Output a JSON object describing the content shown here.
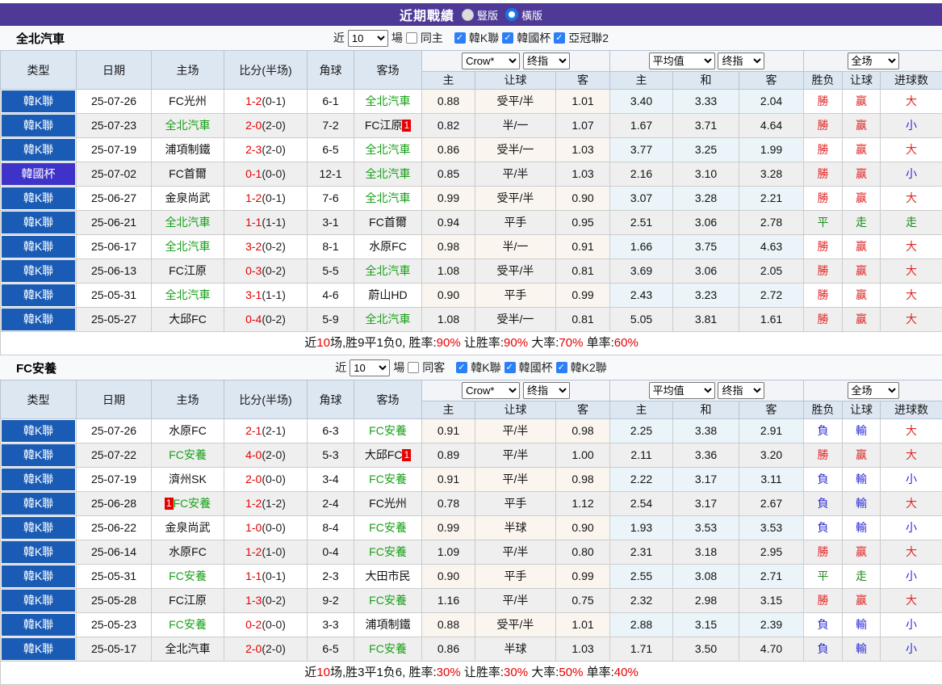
{
  "topbar": {
    "title": "近期戰績",
    "vertical": "豎版",
    "horizontal": "橫版"
  },
  "colors": {
    "topbar_purple": "#4e3a96",
    "k_league_blue": "#1a5cb5",
    "cup_league_purple": "#3e32c8",
    "team_green": "#18a018",
    "score_red": "#e60000",
    "win_red": "#e02626",
    "draw_green": "#1f8a1f",
    "lose_blue": "#2c2cd4"
  },
  "labels": {
    "near": "近",
    "games": "場"
  },
  "headers": {
    "type": "类型",
    "date": "日期",
    "home": "主场",
    "score": "比分(半场)",
    "corner": "角球",
    "away": "客场",
    "selects": {
      "bookmaker": "Crow*",
      "final1": "终指",
      "average": "平均值",
      "final2": "终指",
      "scope": "全场"
    },
    "sub": [
      "主",
      "让球",
      "客",
      "主",
      "和",
      "客",
      "胜负",
      "让球",
      "进球数"
    ]
  },
  "sections": [
    {
      "team": "全北汽車",
      "filter": {
        "count": "10",
        "same_label": "同主",
        "leagues": [
          "韓K聯",
          "韓國杯",
          "亞冠聯2"
        ]
      },
      "rows": [
        {
          "lg": "k",
          "league": "韓K聯",
          "date": "25-07-26",
          "home": {
            "name": "FC光州",
            "green": false
          },
          "score": "1-2",
          "half": "(0-1)",
          "corner": "6-1",
          "away": {
            "name": "全北汽車",
            "green": true
          },
          "crow": [
            "0.88",
            "受平/半",
            "1.01"
          ],
          "avg": [
            "3.40",
            "3.33",
            "2.04"
          ],
          "res": [
            [
              "勝",
              "r"
            ],
            [
              "赢",
              "r"
            ],
            [
              "大",
              "r"
            ]
          ]
        },
        {
          "lg": "k",
          "league": "韓K聯",
          "date": "25-07-23",
          "home": {
            "name": "全北汽車",
            "green": true
          },
          "score": "2-0",
          "half": "(2-0)",
          "corner": "7-2",
          "away": {
            "name": "FC江原",
            "green": false,
            "badge": "1",
            "badgePos": "after"
          },
          "crow": [
            "0.82",
            "半/一",
            "1.07"
          ],
          "avg": [
            "1.67",
            "3.71",
            "4.64"
          ],
          "res": [
            [
              "勝",
              "r"
            ],
            [
              "赢",
              "r"
            ],
            [
              "小",
              "b"
            ]
          ]
        },
        {
          "lg": "k",
          "league": "韓K聯",
          "date": "25-07-19",
          "home": {
            "name": "浦項制鐵",
            "green": false
          },
          "score": "2-3",
          "half": "(2-0)",
          "corner": "6-5",
          "away": {
            "name": "全北汽車",
            "green": true
          },
          "crow": [
            "0.86",
            "受半/一",
            "1.03"
          ],
          "avg": [
            "3.77",
            "3.25",
            "1.99"
          ],
          "res": [
            [
              "勝",
              "r"
            ],
            [
              "赢",
              "r"
            ],
            [
              "大",
              "r"
            ]
          ]
        },
        {
          "lg": "cup",
          "league": "韓國杯",
          "date": "25-07-02",
          "home": {
            "name": "FC首爾",
            "green": false
          },
          "score": "0-1",
          "half": "(0-0)",
          "corner": "12-1",
          "away": {
            "name": "全北汽車",
            "green": true
          },
          "crow": [
            "0.85",
            "平/半",
            "1.03"
          ],
          "avg": [
            "2.16",
            "3.10",
            "3.28"
          ],
          "res": [
            [
              "勝",
              "r"
            ],
            [
              "赢",
              "r"
            ],
            [
              "小",
              "b"
            ]
          ]
        },
        {
          "lg": "k",
          "league": "韓K聯",
          "date": "25-06-27",
          "home": {
            "name": "金泉尚武",
            "green": false
          },
          "score": "1-2",
          "half": "(0-1)",
          "corner": "7-6",
          "away": {
            "name": "全北汽車",
            "green": true
          },
          "crow": [
            "0.99",
            "受平/半",
            "0.90"
          ],
          "avg": [
            "3.07",
            "3.28",
            "2.21"
          ],
          "res": [
            [
              "勝",
              "r"
            ],
            [
              "赢",
              "r"
            ],
            [
              "大",
              "r"
            ]
          ]
        },
        {
          "lg": "k",
          "league": "韓K聯",
          "date": "25-06-21",
          "home": {
            "name": "全北汽車",
            "green": true
          },
          "score": "1-1",
          "half": "(1-1)",
          "corner": "3-1",
          "away": {
            "name": "FC首爾",
            "green": false
          },
          "crow": [
            "0.94",
            "平手",
            "0.95"
          ],
          "avg": [
            "2.51",
            "3.06",
            "2.78"
          ],
          "res": [
            [
              "平",
              "g"
            ],
            [
              "走",
              "g"
            ],
            [
              "走",
              "g"
            ]
          ]
        },
        {
          "lg": "k",
          "league": "韓K聯",
          "date": "25-06-17",
          "home": {
            "name": "全北汽車",
            "green": true
          },
          "score": "3-2",
          "half": "(0-2)",
          "corner": "8-1",
          "away": {
            "name": "水原FC",
            "green": false
          },
          "crow": [
            "0.98",
            "半/一",
            "0.91"
          ],
          "avg": [
            "1.66",
            "3.75",
            "4.63"
          ],
          "res": [
            [
              "勝",
              "r"
            ],
            [
              "赢",
              "r"
            ],
            [
              "大",
              "r"
            ]
          ]
        },
        {
          "lg": "k",
          "league": "韓K聯",
          "date": "25-06-13",
          "home": {
            "name": "FC江原",
            "green": false
          },
          "score": "0-3",
          "half": "(0-2)",
          "corner": "5-5",
          "away": {
            "name": "全北汽車",
            "green": true
          },
          "crow": [
            "1.08",
            "受平/半",
            "0.81"
          ],
          "avg": [
            "3.69",
            "3.06",
            "2.05"
          ],
          "res": [
            [
              "勝",
              "r"
            ],
            [
              "赢",
              "r"
            ],
            [
              "大",
              "r"
            ]
          ]
        },
        {
          "lg": "k",
          "league": "韓K聯",
          "date": "25-05-31",
          "home": {
            "name": "全北汽車",
            "green": true
          },
          "score": "3-1",
          "half": "(1-1)",
          "corner": "4-6",
          "away": {
            "name": "蔚山HD",
            "green": false
          },
          "crow": [
            "0.90",
            "平手",
            "0.99"
          ],
          "avg": [
            "2.43",
            "3.23",
            "2.72"
          ],
          "res": [
            [
              "勝",
              "r"
            ],
            [
              "赢",
              "r"
            ],
            [
              "大",
              "r"
            ]
          ]
        },
        {
          "lg": "k",
          "league": "韓K聯",
          "date": "25-05-27",
          "home": {
            "name": "大邱FC",
            "green": false
          },
          "score": "0-4",
          "half": "(0-2)",
          "corner": "5-9",
          "away": {
            "name": "全北汽車",
            "green": true
          },
          "crow": [
            "1.08",
            "受半/一",
            "0.81"
          ],
          "avg": [
            "5.05",
            "3.81",
            "1.61"
          ],
          "res": [
            [
              "勝",
              "r"
            ],
            [
              "赢",
              "r"
            ],
            [
              "大",
              "r"
            ]
          ]
        }
      ],
      "summary": [
        {
          "t": "近",
          "r": false
        },
        {
          "t": "10",
          "r": true
        },
        {
          "t": "场,胜9平1负0, 胜率:",
          "r": false
        },
        {
          "t": "90%",
          "r": true
        },
        {
          "t": " 让胜率:",
          "r": false
        },
        {
          "t": "90%",
          "r": true
        },
        {
          "t": " 大率:",
          "r": false
        },
        {
          "t": "70%",
          "r": true
        },
        {
          "t": " 单率:",
          "r": false
        },
        {
          "t": "60%",
          "r": true
        }
      ]
    },
    {
      "team": "FC安養",
      "filter": {
        "count": "10",
        "same_label": "同客",
        "leagues": [
          "韓K聯",
          "韓國杯",
          "韓K2聯"
        ]
      },
      "rows": [
        {
          "lg": "k",
          "league": "韓K聯",
          "date": "25-07-26",
          "home": {
            "name": "水原FC",
            "green": false
          },
          "score": "2-1",
          "half": "(2-1)",
          "corner": "6-3",
          "away": {
            "name": "FC安養",
            "green": true
          },
          "crow": [
            "0.91",
            "平/半",
            "0.98"
          ],
          "avg": [
            "2.25",
            "3.38",
            "2.91"
          ],
          "res": [
            [
              "負",
              "b"
            ],
            [
              "輸",
              "b"
            ],
            [
              "大",
              "r"
            ]
          ]
        },
        {
          "lg": "k",
          "league": "韓K聯",
          "date": "25-07-22",
          "home": {
            "name": "FC安養",
            "green": true
          },
          "score": "4-0",
          "half": "(2-0)",
          "corner": "5-3",
          "away": {
            "name": "大邱FC",
            "green": false,
            "badge": "1",
            "badgePos": "after"
          },
          "crow": [
            "0.89",
            "平/半",
            "1.00"
          ],
          "avg": [
            "2.11",
            "3.36",
            "3.20"
          ],
          "res": [
            [
              "勝",
              "r"
            ],
            [
              "赢",
              "r"
            ],
            [
              "大",
              "r"
            ]
          ]
        },
        {
          "lg": "k",
          "league": "韓K聯",
          "date": "25-07-19",
          "home": {
            "name": "濟州SK",
            "green": false
          },
          "score": "2-0",
          "half": "(0-0)",
          "corner": "3-4",
          "away": {
            "name": "FC安養",
            "green": true
          },
          "crow": [
            "0.91",
            "平/半",
            "0.98"
          ],
          "avg": [
            "2.22",
            "3.17",
            "3.11"
          ],
          "res": [
            [
              "負",
              "b"
            ],
            [
              "輸",
              "b"
            ],
            [
              "小",
              "b"
            ]
          ]
        },
        {
          "lg": "k",
          "league": "韓K聯",
          "date": "25-06-28",
          "home": {
            "name": "FC安養",
            "green": true,
            "badge": "1",
            "badgePos": "before"
          },
          "score": "1-2",
          "half": "(1-2)",
          "corner": "2-4",
          "away": {
            "name": "FC光州",
            "green": false
          },
          "crow": [
            "0.78",
            "平手",
            "1.12"
          ],
          "avg": [
            "2.54",
            "3.17",
            "2.67"
          ],
          "res": [
            [
              "負",
              "b"
            ],
            [
              "輸",
              "b"
            ],
            [
              "大",
              "r"
            ]
          ]
        },
        {
          "lg": "k",
          "league": "韓K聯",
          "date": "25-06-22",
          "home": {
            "name": "金泉尚武",
            "green": false
          },
          "score": "1-0",
          "half": "(0-0)",
          "corner": "8-4",
          "away": {
            "name": "FC安養",
            "green": true
          },
          "crow": [
            "0.99",
            "半球",
            "0.90"
          ],
          "avg": [
            "1.93",
            "3.53",
            "3.53"
          ],
          "res": [
            [
              "負",
              "b"
            ],
            [
              "輸",
              "b"
            ],
            [
              "小",
              "b"
            ]
          ]
        },
        {
          "lg": "k",
          "league": "韓K聯",
          "date": "25-06-14",
          "home": {
            "name": "水原FC",
            "green": false
          },
          "score": "1-2",
          "half": "(1-0)",
          "corner": "0-4",
          "away": {
            "name": "FC安養",
            "green": true
          },
          "crow": [
            "1.09",
            "平/半",
            "0.80"
          ],
          "avg": [
            "2.31",
            "3.18",
            "2.95"
          ],
          "res": [
            [
              "勝",
              "r"
            ],
            [
              "赢",
              "r"
            ],
            [
              "大",
              "r"
            ]
          ]
        },
        {
          "lg": "k",
          "league": "韓K聯",
          "date": "25-05-31",
          "home": {
            "name": "FC安養",
            "green": true
          },
          "score": "1-1",
          "half": "(0-1)",
          "corner": "2-3",
          "away": {
            "name": "大田市民",
            "green": false
          },
          "crow": [
            "0.90",
            "平手",
            "0.99"
          ],
          "avg": [
            "2.55",
            "3.08",
            "2.71"
          ],
          "res": [
            [
              "平",
              "g"
            ],
            [
              "走",
              "g"
            ],
            [
              "小",
              "b"
            ]
          ]
        },
        {
          "lg": "k",
          "league": "韓K聯",
          "date": "25-05-28",
          "home": {
            "name": "FC江原",
            "green": false
          },
          "score": "1-3",
          "half": "(0-2)",
          "corner": "9-2",
          "away": {
            "name": "FC安養",
            "green": true
          },
          "crow": [
            "1.16",
            "平/半",
            "0.75"
          ],
          "avg": [
            "2.32",
            "2.98",
            "3.15"
          ],
          "res": [
            [
              "勝",
              "r"
            ],
            [
              "赢",
              "r"
            ],
            [
              "大",
              "r"
            ]
          ]
        },
        {
          "lg": "k",
          "league": "韓K聯",
          "date": "25-05-23",
          "home": {
            "name": "FC安養",
            "green": true
          },
          "score": "0-2",
          "half": "(0-0)",
          "corner": "3-3",
          "away": {
            "name": "浦項制鐵",
            "green": false
          },
          "crow": [
            "0.88",
            "受平/半",
            "1.01"
          ],
          "avg": [
            "2.88",
            "3.15",
            "2.39"
          ],
          "res": [
            [
              "負",
              "b"
            ],
            [
              "輸",
              "b"
            ],
            [
              "小",
              "b"
            ]
          ]
        },
        {
          "lg": "k",
          "league": "韓K聯",
          "date": "25-05-17",
          "home": {
            "name": "全北汽車",
            "green": false
          },
          "score": "2-0",
          "half": "(2-0)",
          "corner": "6-5",
          "away": {
            "name": "FC安養",
            "green": true
          },
          "crow": [
            "0.86",
            "半球",
            "1.03"
          ],
          "avg": [
            "1.71",
            "3.50",
            "4.70"
          ],
          "res": [
            [
              "負",
              "b"
            ],
            [
              "輸",
              "b"
            ],
            [
              "小",
              "b"
            ]
          ]
        }
      ],
      "summary": [
        {
          "t": "近",
          "r": false
        },
        {
          "t": "10",
          "r": true
        },
        {
          "t": "场,胜3平1负6, 胜率:",
          "r": false
        },
        {
          "t": "30%",
          "r": true
        },
        {
          "t": " 让胜率:",
          "r": false
        },
        {
          "t": "30%",
          "r": true
        },
        {
          "t": " 大率:",
          "r": false
        },
        {
          "t": "50%",
          "r": true
        },
        {
          "t": " 单率:",
          "r": false
        },
        {
          "t": "40%",
          "r": true
        }
      ]
    }
  ]
}
